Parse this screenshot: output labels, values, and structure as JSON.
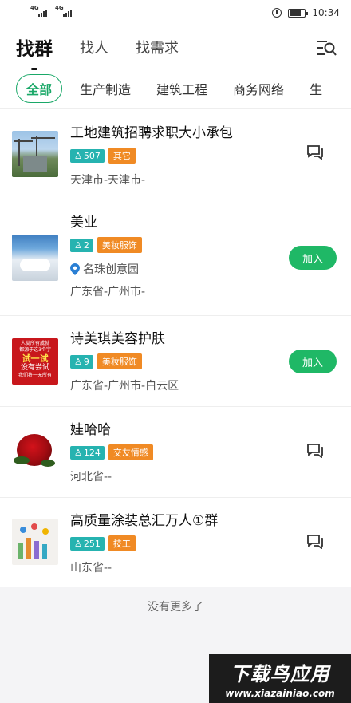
{
  "status_bar": {
    "net1": "4G",
    "net2": "4G",
    "time": "10:34"
  },
  "nav": {
    "tabs": [
      "找群",
      "找人",
      "找需求"
    ]
  },
  "categories": [
    "全部",
    "生产制造",
    "建筑工程",
    "商务网络",
    "生"
  ],
  "groups": [
    {
      "name": "工地建筑招聘求职大小承包",
      "members": "507",
      "category": "其它",
      "location": "",
      "region": "天津市-天津市-",
      "action": "chat"
    },
    {
      "name": "美业",
      "members": "2",
      "category": "美妆服饰",
      "location": "名珠创意园",
      "region": "广东省-广州市-",
      "action": "join",
      "action_label": "加入"
    },
    {
      "name": "诗美琪美容护肤",
      "members": "9",
      "category": "美妆服饰",
      "location": "",
      "region": "广东省-广州市-白云区",
      "action": "join",
      "action_label": "加入"
    },
    {
      "name": "娃哈哈",
      "members": "124",
      "category": "交友情感",
      "location": "",
      "region": "河北省--",
      "action": "chat"
    },
    {
      "name": "高质量涂装总汇万人①群",
      "members": "251",
      "category": "技工",
      "location": "",
      "region": "山东省--",
      "action": "chat"
    }
  ],
  "thumb3_text": [
    "人类所有成就",
    "都源于这3个字",
    "试一试",
    "没有尝试",
    "我们将一无所有"
  ],
  "footer": "没有更多了",
  "watermark": {
    "title": "下载鸟应用",
    "url": "www.xiazainiao.com"
  },
  "colors": {
    "accent_green": "#1aa868",
    "join_green": "#1fb866",
    "member_tag": "#26b3b0",
    "category_tag": "#f08a24"
  }
}
